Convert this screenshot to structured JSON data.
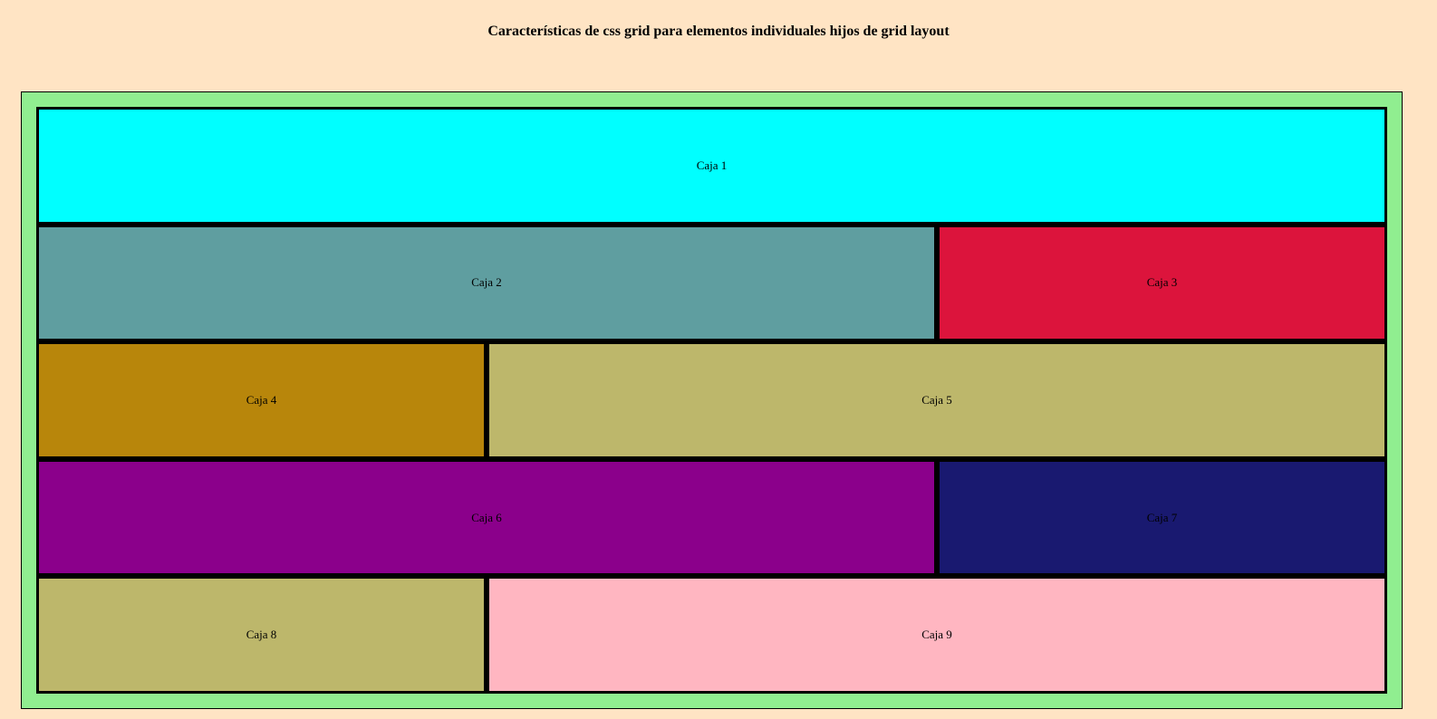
{
  "title": "Características de css grid para elementos individuales hijos de grid layout",
  "colors": {
    "page_background": "#ffe4c4",
    "container_background": "#90ee90"
  },
  "boxes": [
    {
      "label": "Caja 1",
      "color": "#00ffff"
    },
    {
      "label": "Caja 2",
      "color": "#5f9ea0"
    },
    {
      "label": "Caja 3",
      "color": "#dc143c"
    },
    {
      "label": "Caja 4",
      "color": "#b8860b"
    },
    {
      "label": "Caja 5",
      "color": "#bdb76b"
    },
    {
      "label": "Caja 6",
      "color": "#8b008b"
    },
    {
      "label": "Caja 7",
      "color": "#191970"
    },
    {
      "label": "Caja 8",
      "color": "#bdb76b"
    },
    {
      "label": "Caja 9",
      "color": "#ffb6c1"
    }
  ]
}
